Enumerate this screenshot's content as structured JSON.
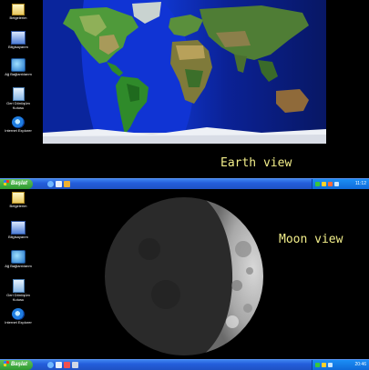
{
  "earth_panel": {
    "caption": "Earth view",
    "desktop_icons": [
      {
        "label": "Belgelerim",
        "icon": "documents-icon"
      },
      {
        "label": "Bilgisayarım",
        "icon": "computer-icon"
      },
      {
        "label": "Ağ Bağlantılarım",
        "icon": "network-icon"
      },
      {
        "label": "Geri Dönüşüm Kutusu",
        "icon": "recycle-bin-icon"
      },
      {
        "label": "Internet Explorer",
        "icon": "internet-explorer-icon"
      }
    ],
    "taskbar": {
      "start_label": "Başlat",
      "clock": "11:12"
    }
  },
  "moon_panel": {
    "caption": "Moon view",
    "desktop_icons": [
      {
        "label": "Belgelerim",
        "icon": "documents-icon"
      },
      {
        "label": "Bilgisayarım",
        "icon": "computer-icon"
      },
      {
        "label": "Ağ Bağlantılarım",
        "icon": "network-icon"
      },
      {
        "label": "Geri Dönüşüm Kutusu",
        "icon": "recycle-bin-icon"
      },
      {
        "label": "Internet Explorer",
        "icon": "internet-explorer-icon"
      }
    ],
    "taskbar": {
      "start_label": "Başlat",
      "clock": "20:46"
    }
  },
  "colors": {
    "taskbar": "#245edb",
    "start_button": "#3bb13b",
    "caption": "#f2ee8a",
    "ocean": "#1030c8",
    "night_ocean": "#05104a"
  }
}
